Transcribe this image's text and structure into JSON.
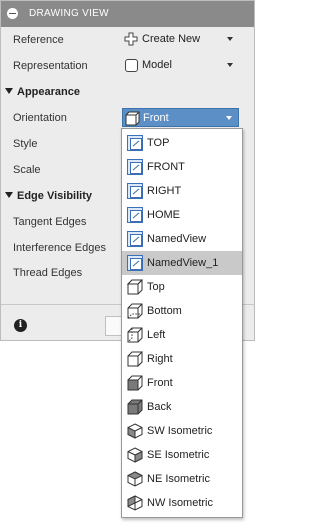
{
  "panel": {
    "title": "DRAWING VIEW",
    "rows": {
      "reference": {
        "label": "Reference",
        "value": "Create New"
      },
      "representation": {
        "label": "Representation",
        "value": "Model"
      }
    },
    "appearance": {
      "section": "Appearance",
      "orientation": {
        "label": "Orientation",
        "value": "Front"
      },
      "style_label": "Style",
      "scale_label": "Scale"
    },
    "edge_visibility": {
      "section": "Edge Visibility",
      "tangent_label": "Tangent Edges",
      "interference_label": "Interference Edges",
      "thread_label": "Thread Edges"
    },
    "info_glyph": "i"
  },
  "orientation_options": [
    {
      "label": "TOP",
      "icon": "named-view-icon"
    },
    {
      "label": "FRONT",
      "icon": "named-view-icon"
    },
    {
      "label": "RIGHT",
      "icon": "named-view-icon"
    },
    {
      "label": "HOME",
      "icon": "named-view-icon"
    },
    {
      "label": "NamedView",
      "icon": "named-view-icon"
    },
    {
      "label": "NamedView_1",
      "icon": "named-view-icon",
      "selected": true
    },
    {
      "label": "Top",
      "icon": "cube-top-icon"
    },
    {
      "label": "Bottom",
      "icon": "cube-bottom-icon"
    },
    {
      "label": "Left",
      "icon": "cube-left-icon"
    },
    {
      "label": "Right",
      "icon": "cube-right-icon"
    },
    {
      "label": "Front",
      "icon": "cube-front-icon"
    },
    {
      "label": "Back",
      "icon": "cube-back-icon"
    },
    {
      "label": "SW Isometric",
      "icon": "iso-sw-icon"
    },
    {
      "label": "SE Isometric",
      "icon": "iso-se-icon"
    },
    {
      "label": "NE Isometric",
      "icon": "iso-ne-icon"
    },
    {
      "label": "NW Isometric",
      "icon": "iso-nw-icon"
    }
  ],
  "colors": {
    "header": "#8a8a8a",
    "active_dropdown": "#5b8fc6",
    "selected_item": "#c9c9c9",
    "panel_bg": "#ececec"
  }
}
